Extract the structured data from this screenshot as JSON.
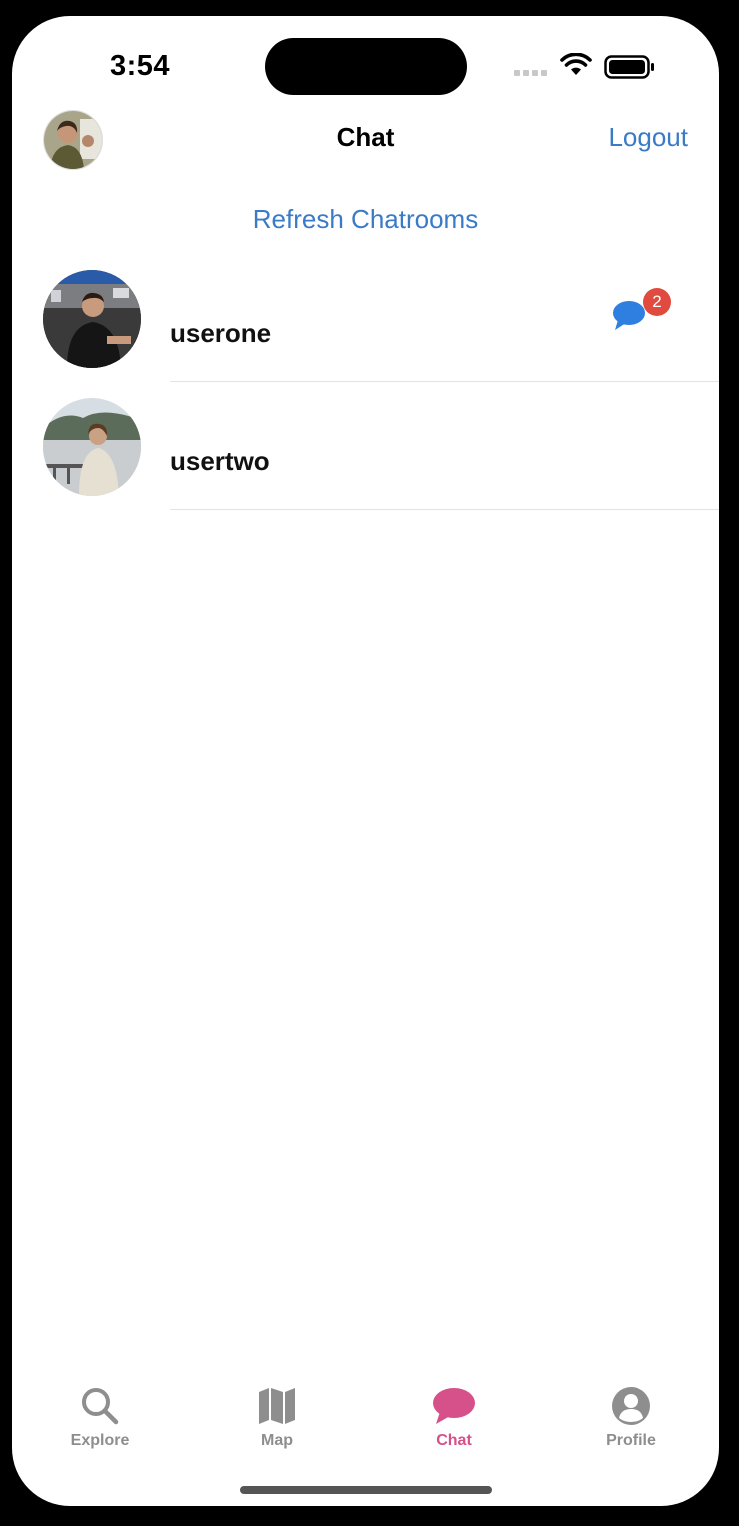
{
  "status_bar": {
    "time": "3:54"
  },
  "header": {
    "title": "Chat",
    "logout_label": "Logout",
    "avatar_icon": "user-avatar-icon"
  },
  "refresh_label": "Refresh Chatrooms",
  "chatrooms": [
    {
      "name": "userone",
      "unread_count": "2",
      "has_unread": true
    },
    {
      "name": "usertwo",
      "unread_count": "",
      "has_unread": false
    }
  ],
  "tabs": [
    {
      "label": "Explore",
      "icon": "search-icon",
      "active": false
    },
    {
      "label": "Map",
      "icon": "map-icon",
      "active": false
    },
    {
      "label": "Chat",
      "icon": "chat-bubble-icon",
      "active": true
    },
    {
      "label": "Profile",
      "icon": "person-icon",
      "active": false
    }
  ],
  "colors": {
    "link": "#3a7bc8",
    "active_tab": "#d6508a",
    "inactive_tab": "#8e8e8e",
    "badge": "#e04a3f",
    "message_icon": "#2f7fe0"
  }
}
